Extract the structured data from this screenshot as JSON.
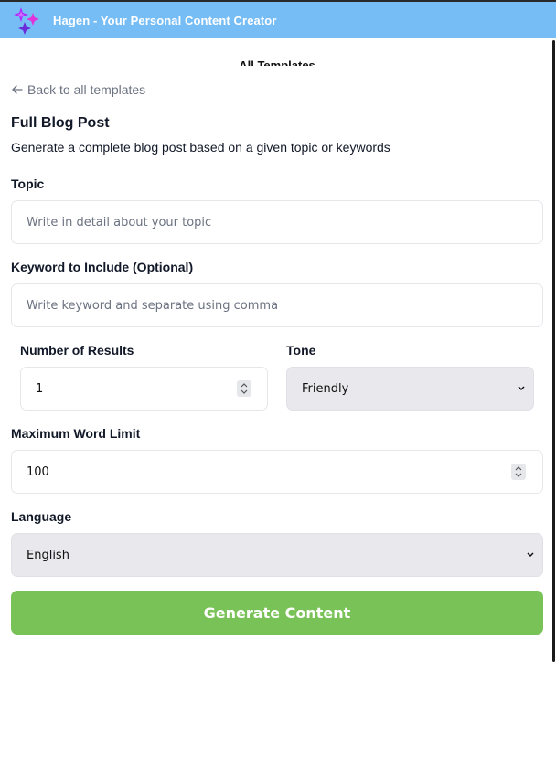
{
  "header": {
    "app_title": "Hagen - Your Personal Content Creator",
    "logo_icon": "sparkle-logo-icon",
    "background": "#76bdf6"
  },
  "nav": {
    "all_templates_label": "All Templates",
    "back_label": "Back to all templates"
  },
  "template": {
    "title": "Full Blog Post",
    "description": "Generate a complete blog post based on a given topic or keywords"
  },
  "form": {
    "topic": {
      "label": "Topic",
      "placeholder": "Write in detail about your topic",
      "value": ""
    },
    "keywords": {
      "label": "Keyword to Include (Optional)",
      "placeholder": "Write keyword and separate using comma",
      "value": ""
    },
    "num_results": {
      "label": "Number of Results",
      "value": "1"
    },
    "tone": {
      "label": "Tone",
      "selected": "Friendly"
    },
    "max_words": {
      "label": "Maximum Word Limit",
      "value": "100"
    },
    "language": {
      "label": "Language",
      "selected": "English"
    },
    "submit_label": "Generate Content",
    "submit_color": "#79c257"
  }
}
